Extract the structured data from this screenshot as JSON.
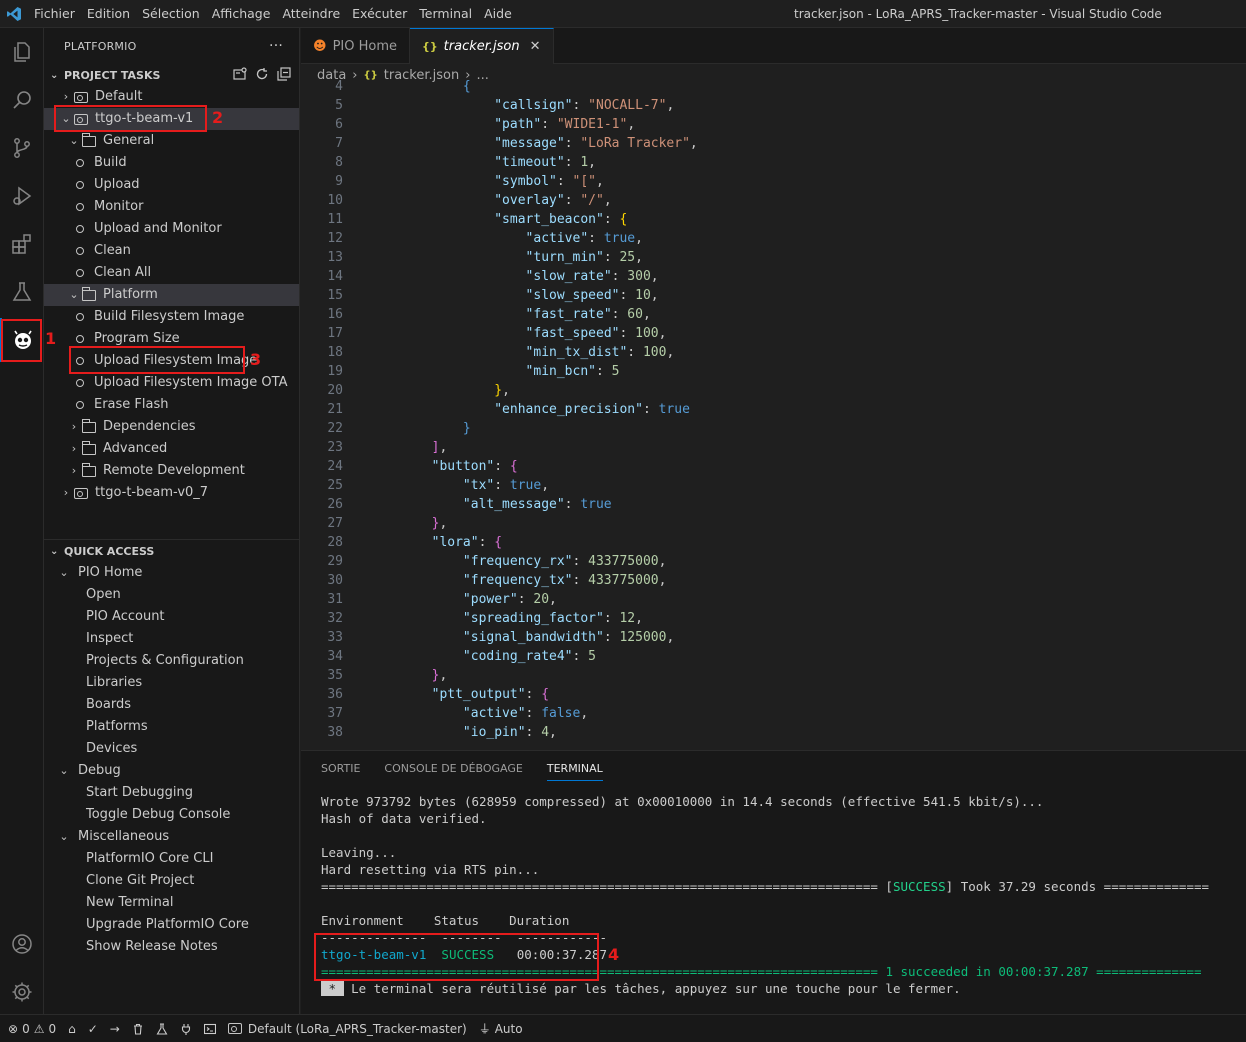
{
  "window": {
    "menu": [
      "Fichier",
      "Edition",
      "Sélection",
      "Affichage",
      "Atteindre",
      "Exécuter",
      "Terminal",
      "Aide"
    ],
    "title": "tracker.json - LoRa_APRS_Tracker-master - Visual Studio Code"
  },
  "activitybar": {
    "items": [
      "explorer-icon",
      "search-icon",
      "source-control-icon",
      "run-debug-icon",
      "extensions-icon",
      "testing-icon",
      "platformio-icon"
    ],
    "bottom": [
      "account-icon",
      "settings-gear-icon"
    ]
  },
  "sidebar": {
    "title": "PLATFORMIO",
    "more": "···",
    "project_tasks": {
      "header": "PROJECT TASKS",
      "default_env": "Default",
      "env1": "ttgo-t-beam-v1",
      "general": "General",
      "general_items": [
        "Build",
        "Upload",
        "Monitor",
        "Upload and Monitor",
        "Clean",
        "Clean All"
      ],
      "platform": "Platform",
      "platform_items": [
        "Build Filesystem Image",
        "Program Size",
        "Upload Filesystem Image",
        "Upload Filesystem Image OTA",
        "Erase Flash"
      ],
      "folders": [
        "Dependencies",
        "Advanced",
        "Remote Development"
      ],
      "env2": "ttgo-t-beam-v0_7"
    },
    "quick_access": {
      "header": "QUICK ACCESS",
      "pio_home": "PIO Home",
      "pio_home_items": [
        "Open",
        "PIO Account",
        "Inspect",
        "Projects & Configuration",
        "Libraries",
        "Boards",
        "Platforms",
        "Devices"
      ],
      "debug": "Debug",
      "debug_items": [
        "Start Debugging",
        "Toggle Debug Console"
      ],
      "misc": "Miscellaneous",
      "misc_items": [
        "PlatformIO Core CLI",
        "Clone Git Project",
        "New Terminal",
        "Upgrade PlatformIO Core",
        "Show Release Notes"
      ]
    }
  },
  "annotations": [
    "1",
    "2",
    "3",
    "4"
  ],
  "editor": {
    "tabs": [
      {
        "label": "PIO Home",
        "icon": "platformio-icon"
      },
      {
        "label": "tracker.json",
        "icon": "json-braces-icon",
        "close": "✕"
      }
    ],
    "breadcrumb": [
      "data",
      "tracker.json",
      "..."
    ],
    "code_lines": [
      {
        "n": "4",
        "tokens": [
          [
            "",
            "            "
          ],
          [
            "b",
            "{"
          ]
        ]
      },
      {
        "n": "5",
        "tokens": [
          [
            "",
            "                "
          ],
          [
            "k",
            "\"callsign\""
          ],
          [
            "",
            ": "
          ],
          [
            "s",
            "\"NOCALL-7\""
          ],
          [
            "",
            ","
          ]
        ]
      },
      {
        "n": "6",
        "tokens": [
          [
            "",
            "                "
          ],
          [
            "k",
            "\"path\""
          ],
          [
            "",
            ": "
          ],
          [
            "s",
            "\"WIDE1-1\""
          ],
          [
            "",
            ","
          ]
        ]
      },
      {
        "n": "7",
        "tokens": [
          [
            "",
            "                "
          ],
          [
            "k",
            "\"message\""
          ],
          [
            "",
            ": "
          ],
          [
            "s",
            "\"LoRa Tracker\""
          ],
          [
            "",
            ","
          ]
        ]
      },
      {
        "n": "8",
        "tokens": [
          [
            "",
            "                "
          ],
          [
            "k",
            "\"timeout\""
          ],
          [
            "",
            ": "
          ],
          [
            "n",
            "1"
          ],
          [
            "",
            ","
          ]
        ]
      },
      {
        "n": "9",
        "tokens": [
          [
            "",
            "                "
          ],
          [
            "k",
            "\"symbol\""
          ],
          [
            "",
            ": "
          ],
          [
            "s",
            "\"[\""
          ],
          [
            "",
            ","
          ]
        ]
      },
      {
        "n": "10",
        "tokens": [
          [
            "",
            "                "
          ],
          [
            "k",
            "\"overlay\""
          ],
          [
            "",
            ": "
          ],
          [
            "s",
            "\"/\""
          ],
          [
            "",
            ","
          ]
        ]
      },
      {
        "n": "11",
        "tokens": [
          [
            "",
            "                "
          ],
          [
            "k",
            "\"smart_beacon\""
          ],
          [
            "",
            ": "
          ],
          [
            "y",
            "{"
          ]
        ]
      },
      {
        "n": "12",
        "tokens": [
          [
            "",
            "                    "
          ],
          [
            "k",
            "\"active\""
          ],
          [
            "",
            ": "
          ],
          [
            "b",
            "true"
          ],
          [
            "",
            ","
          ]
        ]
      },
      {
        "n": "13",
        "tokens": [
          [
            "",
            "                    "
          ],
          [
            "k",
            "\"turn_min\""
          ],
          [
            "",
            ": "
          ],
          [
            "n",
            "25"
          ],
          [
            "",
            ","
          ]
        ]
      },
      {
        "n": "14",
        "tokens": [
          [
            "",
            "                    "
          ],
          [
            "k",
            "\"slow_rate\""
          ],
          [
            "",
            ": "
          ],
          [
            "n",
            "300"
          ],
          [
            "",
            ","
          ]
        ]
      },
      {
        "n": "15",
        "tokens": [
          [
            "",
            "                    "
          ],
          [
            "k",
            "\"slow_speed\""
          ],
          [
            "",
            ": "
          ],
          [
            "n",
            "10"
          ],
          [
            "",
            ","
          ]
        ]
      },
      {
        "n": "16",
        "tokens": [
          [
            "",
            "                    "
          ],
          [
            "k",
            "\"fast_rate\""
          ],
          [
            "",
            ": "
          ],
          [
            "n",
            "60"
          ],
          [
            "",
            ","
          ]
        ]
      },
      {
        "n": "17",
        "tokens": [
          [
            "",
            "                    "
          ],
          [
            "k",
            "\"fast_speed\""
          ],
          [
            "",
            ": "
          ],
          [
            "n",
            "100"
          ],
          [
            "",
            ","
          ]
        ]
      },
      {
        "n": "18",
        "tokens": [
          [
            "",
            "                    "
          ],
          [
            "k",
            "\"min_tx_dist\""
          ],
          [
            "",
            ": "
          ],
          [
            "n",
            "100"
          ],
          [
            "",
            ","
          ]
        ]
      },
      {
        "n": "19",
        "tokens": [
          [
            "",
            "                    "
          ],
          [
            "k",
            "\"min_bcn\""
          ],
          [
            "",
            ": "
          ],
          [
            "n",
            "5"
          ]
        ]
      },
      {
        "n": "20",
        "tokens": [
          [
            "",
            "                "
          ],
          [
            "y",
            "}"
          ],
          [
            "",
            ","
          ]
        ]
      },
      {
        "n": "21",
        "tokens": [
          [
            "",
            "                "
          ],
          [
            "k",
            "\"enhance_precision\""
          ],
          [
            "",
            ": "
          ],
          [
            "b",
            "true"
          ]
        ]
      },
      {
        "n": "22",
        "tokens": [
          [
            "",
            "            "
          ],
          [
            "b",
            "}"
          ]
        ]
      },
      {
        "n": "23",
        "tokens": [
          [
            "",
            "        "
          ],
          [
            "p",
            "]"
          ],
          [
            "",
            ","
          ]
        ]
      },
      {
        "n": "24",
        "tokens": [
          [
            "",
            "        "
          ],
          [
            "k",
            "\"button\""
          ],
          [
            "",
            ": "
          ],
          [
            "p",
            "{"
          ]
        ]
      },
      {
        "n": "25",
        "tokens": [
          [
            "",
            "            "
          ],
          [
            "k",
            "\"tx\""
          ],
          [
            "",
            ": "
          ],
          [
            "b",
            "true"
          ],
          [
            "",
            ","
          ]
        ]
      },
      {
        "n": "26",
        "tokens": [
          [
            "",
            "            "
          ],
          [
            "k",
            "\"alt_message\""
          ],
          [
            "",
            ": "
          ],
          [
            "b",
            "true"
          ]
        ]
      },
      {
        "n": "27",
        "tokens": [
          [
            "",
            "        "
          ],
          [
            "p",
            "}"
          ],
          [
            "",
            ","
          ]
        ]
      },
      {
        "n": "28",
        "tokens": [
          [
            "",
            "        "
          ],
          [
            "k",
            "\"lora\""
          ],
          [
            "",
            ": "
          ],
          [
            "p",
            "{"
          ]
        ]
      },
      {
        "n": "29",
        "tokens": [
          [
            "",
            "            "
          ],
          [
            "k",
            "\"frequency_rx\""
          ],
          [
            "",
            ": "
          ],
          [
            "n",
            "433775000"
          ],
          [
            "",
            ","
          ]
        ]
      },
      {
        "n": "30",
        "tokens": [
          [
            "",
            "            "
          ],
          [
            "k",
            "\"frequency_tx\""
          ],
          [
            "",
            ": "
          ],
          [
            "n",
            "433775000"
          ],
          [
            "",
            ","
          ]
        ]
      },
      {
        "n": "31",
        "tokens": [
          [
            "",
            "            "
          ],
          [
            "k",
            "\"power\""
          ],
          [
            "",
            ": "
          ],
          [
            "n",
            "20"
          ],
          [
            "",
            ","
          ]
        ]
      },
      {
        "n": "32",
        "tokens": [
          [
            "",
            "            "
          ],
          [
            "k",
            "\"spreading_factor\""
          ],
          [
            "",
            ": "
          ],
          [
            "n",
            "12"
          ],
          [
            "",
            ","
          ]
        ]
      },
      {
        "n": "33",
        "tokens": [
          [
            "",
            "            "
          ],
          [
            "k",
            "\"signal_bandwidth\""
          ],
          [
            "",
            ": "
          ],
          [
            "n",
            "125000"
          ],
          [
            "",
            ","
          ]
        ]
      },
      {
        "n": "34",
        "tokens": [
          [
            "",
            "            "
          ],
          [
            "k",
            "\"coding_rate4\""
          ],
          [
            "",
            ": "
          ],
          [
            "n",
            "5"
          ]
        ]
      },
      {
        "n": "35",
        "tokens": [
          [
            "",
            "        "
          ],
          [
            "p",
            "}"
          ],
          [
            "",
            ","
          ]
        ]
      },
      {
        "n": "36",
        "tokens": [
          [
            "",
            "        "
          ],
          [
            "k",
            "\"ptt_output\""
          ],
          [
            "",
            ": "
          ],
          [
            "p",
            "{"
          ]
        ]
      },
      {
        "n": "37",
        "tokens": [
          [
            "",
            "            "
          ],
          [
            "k",
            "\"active\""
          ],
          [
            "",
            ": "
          ],
          [
            "b",
            "false"
          ],
          [
            "",
            ","
          ]
        ]
      },
      {
        "n": "38",
        "tokens": [
          [
            "",
            "            "
          ],
          [
            "k",
            "\"io_pin\""
          ],
          [
            "",
            ": "
          ],
          [
            "n",
            "4"
          ],
          [
            "",
            ","
          ]
        ]
      }
    ]
  },
  "panel": {
    "tabs": [
      "SORTIE",
      "CONSOLE DE DÉBOGAGE",
      "TERMINAL"
    ],
    "terminal": {
      "line1": "Wrote 973792 bytes (628959 compressed) at 0x00010000 in 14.4 seconds (effective 541.5 kbit/s)...",
      "line2": "Hash of data verified.",
      "line3": "Leaving...",
      "line4": "Hard resetting via RTS pin...",
      "sep_left": "========================================================================== [",
      "success_word": "SUCCESS",
      "sep_right": "] Took 37.29 seconds ==============",
      "table_header": "Environment    Status    Duration",
      "table_rule": "--------------  --------  ------------",
      "env": "ttgo-t-beam-v1",
      "status": "SUCCESS",
      "duration": "00:00:37.287",
      "summary_sep": "========================================================================== ",
      "summary": "1 succeeded in 00:00:37.287",
      "summary_tail": " ==============",
      "final_key": " * ",
      "final_msg": " Le terminal sera réutilisé par les tâches, appuyez sur une touche pour le fermer."
    }
  },
  "statusbar": {
    "errors": "0",
    "warnings": "0",
    "env": "Default (LoRa_APRS_Tracker-master)",
    "auto": "Auto"
  }
}
